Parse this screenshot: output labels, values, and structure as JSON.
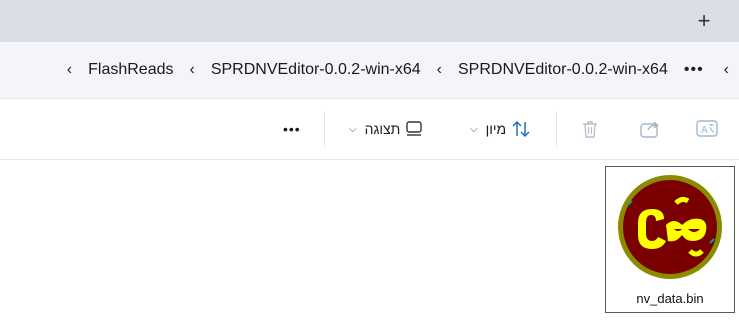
{
  "titlebar": {
    "new_tab": "+"
  },
  "breadcrumb": {
    "items": [
      "SPRDNVEditor-0.0.2-win-x64",
      "SPRDNVEditor-0.0.2-win-x64",
      "FlashReads"
    ],
    "separator": "‹",
    "more": "•••"
  },
  "toolbar": {
    "sort_label": "מיון",
    "view_label": "תצוגה",
    "more": "•••"
  },
  "files": [
    {
      "name": "nv_data.bin",
      "icon": "sprd-bin-file-icon"
    }
  ],
  "colors": {
    "titlebar_bg": "#d9dde4",
    "addressbar_bg": "#f3f5f8",
    "accent": "#1a73c8",
    "icon_dark_red": "#7a0000",
    "icon_yellow": "#ffff00"
  }
}
